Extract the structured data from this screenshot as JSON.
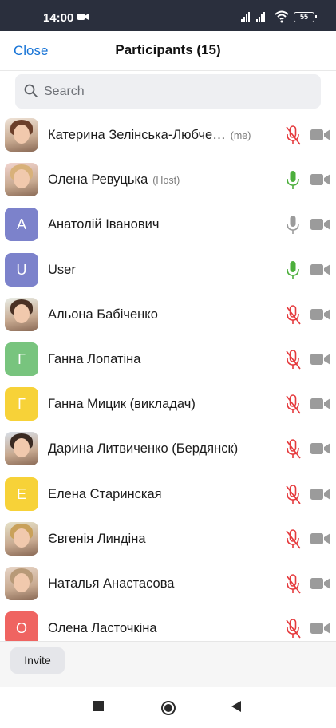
{
  "statusbar": {
    "time": "14:00",
    "battery": "55"
  },
  "header": {
    "close_label": "Close",
    "title": "Participants (15)"
  },
  "search": {
    "placeholder": "Search"
  },
  "participants": [
    {
      "name": "Катерина Зелінська-Любче…",
      "tag": "(me)",
      "avatar": "photo",
      "mic": "muted"
    },
    {
      "name": "Олена Ревуцька",
      "tag": "(Host)",
      "avatar": "photo",
      "mic": "active"
    },
    {
      "name": "Анатолій Іванович",
      "tag": "",
      "avatar": "A",
      "avatar_color": "#7c82cb",
      "mic": "on"
    },
    {
      "name": "User",
      "tag": "",
      "avatar": "U",
      "avatar_color": "#7c82cb",
      "mic": "active"
    },
    {
      "name": "Альона Бабіченко",
      "tag": "",
      "avatar": "photo",
      "mic": "muted"
    },
    {
      "name": "Ганна Лопатіна",
      "tag": "",
      "avatar": "Г",
      "avatar_color": "#78c47e",
      "mic": "muted"
    },
    {
      "name": "Ганна Мицик (викладач)",
      "tag": "",
      "avatar": "Г",
      "avatar_color": "#f7d238",
      "mic": "muted"
    },
    {
      "name": "Дарина Литвиченко (Бердянск)",
      "tag": "",
      "avatar": "photo",
      "mic": "muted"
    },
    {
      "name": "Елена Старинская",
      "tag": "",
      "avatar": "E",
      "avatar_color": "#f7d238",
      "mic": "muted"
    },
    {
      "name": "Євгенія Линдіна",
      "tag": "",
      "avatar": "photo",
      "mic": "muted"
    },
    {
      "name": "Наталья Анастасова",
      "tag": "",
      "avatar": "photo",
      "mic": "muted"
    },
    {
      "name": "Олена Ласточкіна",
      "tag": "",
      "avatar": "О",
      "avatar_color": "#ef6461",
      "mic": "muted"
    }
  ],
  "footer": {
    "invite_label": "Invite"
  },
  "colors": {
    "accent": "#1673d6",
    "mic_active": "#4caf3c",
    "mic_muted": "#e5393c",
    "icon_gray": "#9b9b9b"
  }
}
